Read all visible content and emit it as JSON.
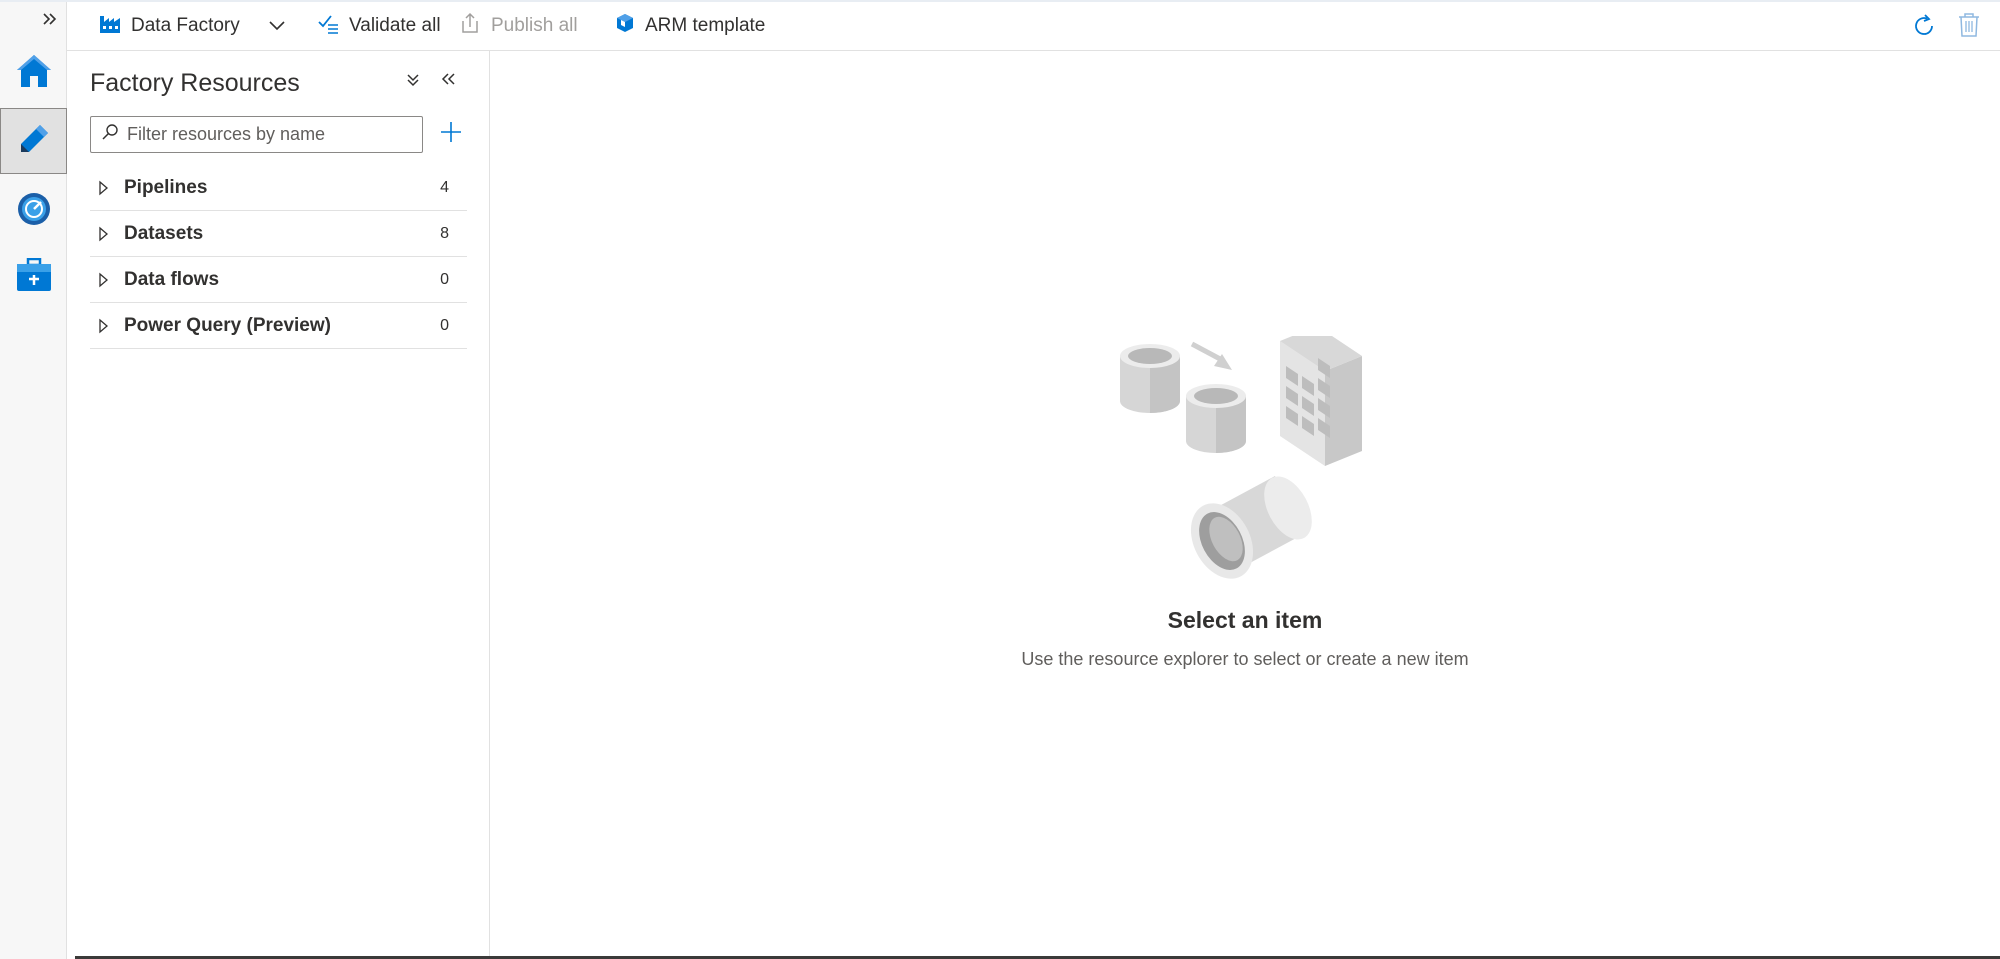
{
  "toolbar": {
    "factory_label": "Data Factory",
    "validate_label": "Validate all",
    "publish_label": "Publish all",
    "arm_label": "ARM template"
  },
  "panel": {
    "title": "Factory Resources",
    "search_placeholder": "Filter resources by name",
    "resources": [
      {
        "name": "Pipelines",
        "count": "4"
      },
      {
        "name": "Datasets",
        "count": "8"
      },
      {
        "name": "Data flows",
        "count": "0"
      },
      {
        "name": "Power Query (Preview)",
        "count": "0"
      }
    ]
  },
  "empty_state": {
    "title": "Select an item",
    "subtitle": "Use the resource explorer to select or create a new item"
  },
  "colors": {
    "accent": "#0078d4",
    "rail_bg": "#f7f7f7",
    "border": "#e1e1e1",
    "text": "#323130",
    "disabled": "#a19f9d"
  }
}
